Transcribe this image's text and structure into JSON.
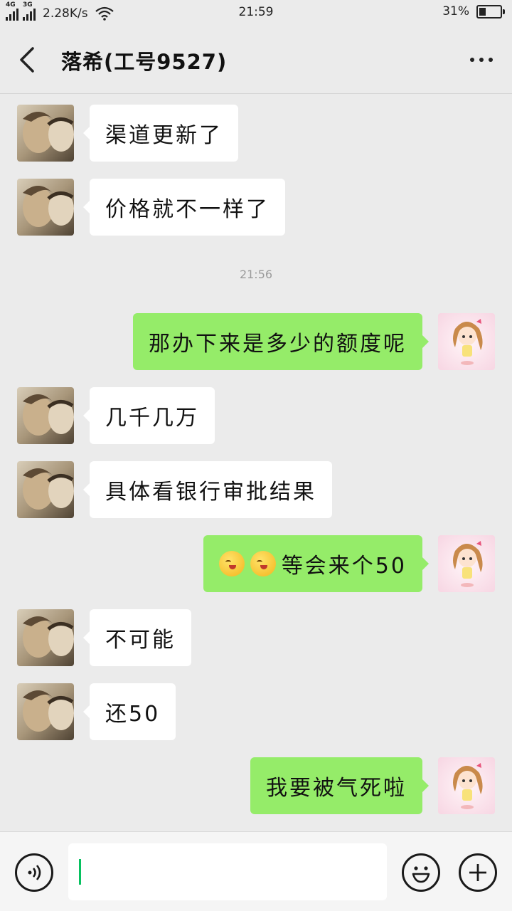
{
  "status_bar": {
    "signal1_tag": "4G",
    "signal2_tag": "3G",
    "net_speed": "2.28K/s",
    "time": "21:59",
    "battery_percent": "31%",
    "battery_level": 0.31
  },
  "header": {
    "title": "落希(工号9527)",
    "back_icon": "chevron-left-icon",
    "more_icon": "more-dots-icon"
  },
  "messages": [
    {
      "side": "in",
      "text": "渠道更新了"
    },
    {
      "side": "in",
      "text": "价格就不一样了"
    },
    {
      "side": "time",
      "text": "21:56"
    },
    {
      "side": "out",
      "text": "那办下来是多少的额度呢"
    },
    {
      "side": "in",
      "text": "几千几万"
    },
    {
      "side": "in",
      "text": "具体看银行审批结果"
    },
    {
      "side": "out",
      "text": "等会来个50",
      "emoji_prefix": [
        "tongue-face-emoji",
        "tongue-face-emoji"
      ]
    },
    {
      "side": "in",
      "text": "不可能"
    },
    {
      "side": "in",
      "text": "还50"
    },
    {
      "side": "out",
      "text": "我要被气死啦"
    }
  ],
  "input_bar": {
    "voice_icon": "voice-icon",
    "emoji_icon": "smiley-icon",
    "plus_icon": "plus-icon",
    "value": "",
    "placeholder": ""
  },
  "colors": {
    "background": "#ebebeb",
    "outgoing_bubble": "#95ec69",
    "incoming_bubble": "#ffffff",
    "caret": "#07c160"
  }
}
